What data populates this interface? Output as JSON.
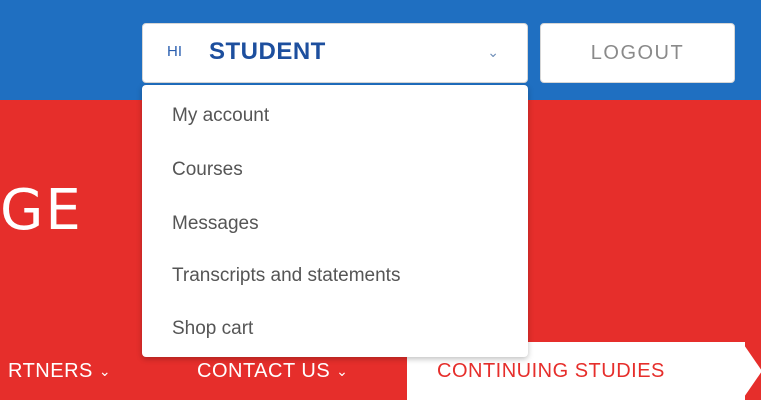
{
  "header": {
    "greeting": "HI",
    "user_name": "STUDENT",
    "logout_label": "LOGOUT",
    "colors": {
      "top_bar": "#1f6fc1",
      "brand_red": "#e62e2b",
      "user_text": "#1d4f9e"
    }
  },
  "user_menu": {
    "items": [
      {
        "label": "My account"
      },
      {
        "label": "Courses"
      },
      {
        "label": "Messages"
      },
      {
        "label": "Transcripts and statements"
      },
      {
        "label": "Shop cart"
      }
    ]
  },
  "hero": {
    "title_fragment": "GE"
  },
  "nav": {
    "items": [
      {
        "label": "RTNERS"
      },
      {
        "label": "CONTACT US"
      },
      {
        "label": "CONTINUING STUDIES"
      }
    ]
  }
}
